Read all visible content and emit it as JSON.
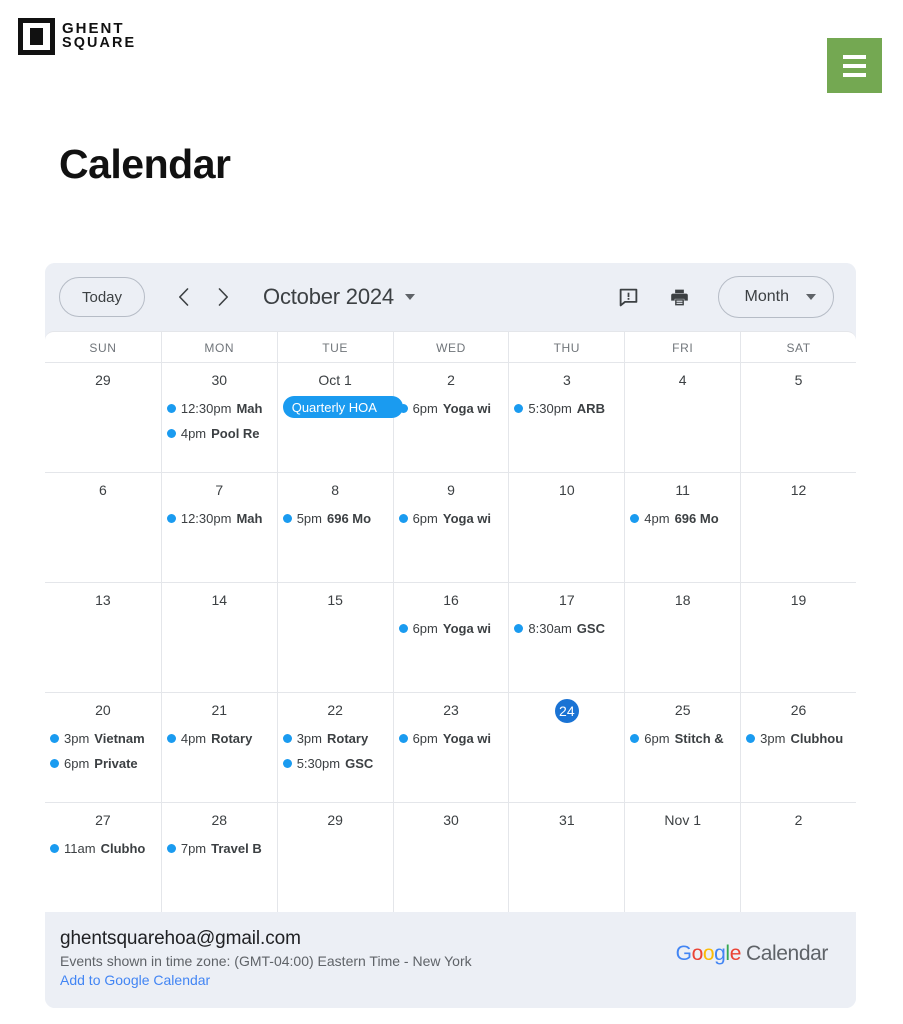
{
  "site": {
    "logo_line1": "GHENT",
    "logo_line2": "SQUARE",
    "logo_icon": "square-logo-icon",
    "menu_icon": "hamburger-menu-icon"
  },
  "page": {
    "title": "Calendar"
  },
  "toolbar": {
    "today_label": "Today",
    "prev_icon": "chevron-left-icon",
    "next_icon": "chevron-right-icon",
    "period_label": "October 2024",
    "period_caret_icon": "chevron-down-icon",
    "feedback_icon": "report-issue-icon",
    "print_icon": "printer-icon",
    "view_label": "Month",
    "view_caret_icon": "chevron-down-icon"
  },
  "calendar": {
    "day_headers": [
      "SUN",
      "MON",
      "TUE",
      "WED",
      "THU",
      "FRI",
      "SAT"
    ],
    "accent_event_color": "#1a9bf0",
    "today_color": "#1a73d4",
    "weeks": [
      {
        "days": [
          {
            "label": "29",
            "today": false,
            "events": []
          },
          {
            "label": "30",
            "today": false,
            "events": [
              {
                "time": "12:30pm",
                "title": "Mah",
                "chip": false
              },
              {
                "time": "4pm",
                "title": "Pool Re",
                "chip": false
              }
            ]
          },
          {
            "label": "Oct 1",
            "today": false,
            "events": [
              {
                "time": "",
                "title": "Quarterly HOA",
                "chip": true
              }
            ]
          },
          {
            "label": "2",
            "today": false,
            "events": [
              {
                "time": "6pm",
                "title": "Yoga wi",
                "chip": false
              }
            ]
          },
          {
            "label": "3",
            "today": false,
            "events": [
              {
                "time": "5:30pm",
                "title": "ARB",
                "chip": false
              }
            ]
          },
          {
            "label": "4",
            "today": false,
            "events": []
          },
          {
            "label": "5",
            "today": false,
            "events": []
          }
        ]
      },
      {
        "days": [
          {
            "label": "6",
            "today": false,
            "events": []
          },
          {
            "label": "7",
            "today": false,
            "events": [
              {
                "time": "12:30pm",
                "title": "Mah",
                "chip": false
              }
            ]
          },
          {
            "label": "8",
            "today": false,
            "events": [
              {
                "time": "5pm",
                "title": "696 Mo",
                "chip": false
              }
            ]
          },
          {
            "label": "9",
            "today": false,
            "events": [
              {
                "time": "6pm",
                "title": "Yoga wi",
                "chip": false
              }
            ]
          },
          {
            "label": "10",
            "today": false,
            "events": []
          },
          {
            "label": "11",
            "today": false,
            "events": [
              {
                "time": "4pm",
                "title": "696 Mo",
                "chip": false
              }
            ]
          },
          {
            "label": "12",
            "today": false,
            "events": []
          }
        ]
      },
      {
        "days": [
          {
            "label": "13",
            "today": false,
            "events": []
          },
          {
            "label": "14",
            "today": false,
            "events": []
          },
          {
            "label": "15",
            "today": false,
            "events": []
          },
          {
            "label": "16",
            "today": false,
            "events": [
              {
                "time": "6pm",
                "title": "Yoga wi",
                "chip": false
              }
            ]
          },
          {
            "label": "17",
            "today": false,
            "events": [
              {
                "time": "8:30am",
                "title": "GSC",
                "chip": false
              }
            ]
          },
          {
            "label": "18",
            "today": false,
            "events": []
          },
          {
            "label": "19",
            "today": false,
            "events": []
          }
        ]
      },
      {
        "days": [
          {
            "label": "20",
            "today": false,
            "events": [
              {
                "time": "3pm",
                "title": "Vietnam",
                "chip": false
              },
              {
                "time": "6pm",
                "title": "Private",
                "chip": false
              }
            ]
          },
          {
            "label": "21",
            "today": false,
            "events": [
              {
                "time": "4pm",
                "title": "Rotary",
                "chip": false
              }
            ]
          },
          {
            "label": "22",
            "today": false,
            "events": [
              {
                "time": "3pm",
                "title": "Rotary",
                "chip": false
              },
              {
                "time": "5:30pm",
                "title": "GSC",
                "chip": false
              }
            ]
          },
          {
            "label": "23",
            "today": false,
            "events": [
              {
                "time": "6pm",
                "title": "Yoga wi",
                "chip": false
              }
            ]
          },
          {
            "label": "24",
            "today": true,
            "events": []
          },
          {
            "label": "25",
            "today": false,
            "events": [
              {
                "time": "6pm",
                "title": "Stitch &",
                "chip": false
              }
            ]
          },
          {
            "label": "26",
            "today": false,
            "events": [
              {
                "time": "3pm",
                "title": "Clubhou",
                "chip": false
              }
            ]
          }
        ]
      },
      {
        "days": [
          {
            "label": "27",
            "today": false,
            "events": [
              {
                "time": "11am",
                "title": "Clubho",
                "chip": false
              }
            ]
          },
          {
            "label": "28",
            "today": false,
            "events": [
              {
                "time": "7pm",
                "title": "Travel B",
                "chip": false
              }
            ]
          },
          {
            "label": "29",
            "today": false,
            "events": []
          },
          {
            "label": "30",
            "today": false,
            "events": []
          },
          {
            "label": "31",
            "today": false,
            "events": []
          },
          {
            "label": "Nov 1",
            "today": false,
            "events": []
          },
          {
            "label": "2",
            "today": false,
            "events": []
          }
        ]
      }
    ]
  },
  "footer": {
    "email": "ghentsquarehoa@gmail.com",
    "timezone": "Events shown in time zone: (GMT-04:00) Eastern Time - New York",
    "add_link": "Add to Google Calendar",
    "brand_letters": [
      "G",
      "o",
      "o",
      "g",
      "l",
      "e"
    ],
    "brand_word": "Calendar"
  }
}
